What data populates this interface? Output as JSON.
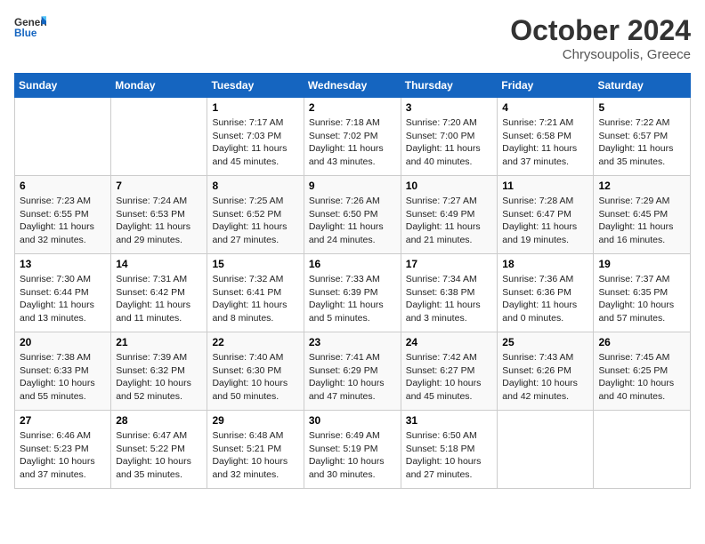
{
  "logo": {
    "line1": "General",
    "line2": "Blue"
  },
  "header": {
    "month": "October 2024",
    "location": "Chrysoupolis, Greece"
  },
  "columns": [
    "Sunday",
    "Monday",
    "Tuesday",
    "Wednesday",
    "Thursday",
    "Friday",
    "Saturday"
  ],
  "rows": [
    [
      {
        "day": "",
        "info": ""
      },
      {
        "day": "",
        "info": ""
      },
      {
        "day": "1",
        "info": "Sunrise: 7:17 AM\nSunset: 7:03 PM\nDaylight: 11 hours and 45 minutes."
      },
      {
        "day": "2",
        "info": "Sunrise: 7:18 AM\nSunset: 7:02 PM\nDaylight: 11 hours and 43 minutes."
      },
      {
        "day": "3",
        "info": "Sunrise: 7:20 AM\nSunset: 7:00 PM\nDaylight: 11 hours and 40 minutes."
      },
      {
        "day": "4",
        "info": "Sunrise: 7:21 AM\nSunset: 6:58 PM\nDaylight: 11 hours and 37 minutes."
      },
      {
        "day": "5",
        "info": "Sunrise: 7:22 AM\nSunset: 6:57 PM\nDaylight: 11 hours and 35 minutes."
      }
    ],
    [
      {
        "day": "6",
        "info": "Sunrise: 7:23 AM\nSunset: 6:55 PM\nDaylight: 11 hours and 32 minutes."
      },
      {
        "day": "7",
        "info": "Sunrise: 7:24 AM\nSunset: 6:53 PM\nDaylight: 11 hours and 29 minutes."
      },
      {
        "day": "8",
        "info": "Sunrise: 7:25 AM\nSunset: 6:52 PM\nDaylight: 11 hours and 27 minutes."
      },
      {
        "day": "9",
        "info": "Sunrise: 7:26 AM\nSunset: 6:50 PM\nDaylight: 11 hours and 24 minutes."
      },
      {
        "day": "10",
        "info": "Sunrise: 7:27 AM\nSunset: 6:49 PM\nDaylight: 11 hours and 21 minutes."
      },
      {
        "day": "11",
        "info": "Sunrise: 7:28 AM\nSunset: 6:47 PM\nDaylight: 11 hours and 19 minutes."
      },
      {
        "day": "12",
        "info": "Sunrise: 7:29 AM\nSunset: 6:45 PM\nDaylight: 11 hours and 16 minutes."
      }
    ],
    [
      {
        "day": "13",
        "info": "Sunrise: 7:30 AM\nSunset: 6:44 PM\nDaylight: 11 hours and 13 minutes."
      },
      {
        "day": "14",
        "info": "Sunrise: 7:31 AM\nSunset: 6:42 PM\nDaylight: 11 hours and 11 minutes."
      },
      {
        "day": "15",
        "info": "Sunrise: 7:32 AM\nSunset: 6:41 PM\nDaylight: 11 hours and 8 minutes."
      },
      {
        "day": "16",
        "info": "Sunrise: 7:33 AM\nSunset: 6:39 PM\nDaylight: 11 hours and 5 minutes."
      },
      {
        "day": "17",
        "info": "Sunrise: 7:34 AM\nSunset: 6:38 PM\nDaylight: 11 hours and 3 minutes."
      },
      {
        "day": "18",
        "info": "Sunrise: 7:36 AM\nSunset: 6:36 PM\nDaylight: 11 hours and 0 minutes."
      },
      {
        "day": "19",
        "info": "Sunrise: 7:37 AM\nSunset: 6:35 PM\nDaylight: 10 hours and 57 minutes."
      }
    ],
    [
      {
        "day": "20",
        "info": "Sunrise: 7:38 AM\nSunset: 6:33 PM\nDaylight: 10 hours and 55 minutes."
      },
      {
        "day": "21",
        "info": "Sunrise: 7:39 AM\nSunset: 6:32 PM\nDaylight: 10 hours and 52 minutes."
      },
      {
        "day": "22",
        "info": "Sunrise: 7:40 AM\nSunset: 6:30 PM\nDaylight: 10 hours and 50 minutes."
      },
      {
        "day": "23",
        "info": "Sunrise: 7:41 AM\nSunset: 6:29 PM\nDaylight: 10 hours and 47 minutes."
      },
      {
        "day": "24",
        "info": "Sunrise: 7:42 AM\nSunset: 6:27 PM\nDaylight: 10 hours and 45 minutes."
      },
      {
        "day": "25",
        "info": "Sunrise: 7:43 AM\nSunset: 6:26 PM\nDaylight: 10 hours and 42 minutes."
      },
      {
        "day": "26",
        "info": "Sunrise: 7:45 AM\nSunset: 6:25 PM\nDaylight: 10 hours and 40 minutes."
      }
    ],
    [
      {
        "day": "27",
        "info": "Sunrise: 6:46 AM\nSunset: 5:23 PM\nDaylight: 10 hours and 37 minutes."
      },
      {
        "day": "28",
        "info": "Sunrise: 6:47 AM\nSunset: 5:22 PM\nDaylight: 10 hours and 35 minutes."
      },
      {
        "day": "29",
        "info": "Sunrise: 6:48 AM\nSunset: 5:21 PM\nDaylight: 10 hours and 32 minutes."
      },
      {
        "day": "30",
        "info": "Sunrise: 6:49 AM\nSunset: 5:19 PM\nDaylight: 10 hours and 30 minutes."
      },
      {
        "day": "31",
        "info": "Sunrise: 6:50 AM\nSunset: 5:18 PM\nDaylight: 10 hours and 27 minutes."
      },
      {
        "day": "",
        "info": ""
      },
      {
        "day": "",
        "info": ""
      }
    ]
  ]
}
